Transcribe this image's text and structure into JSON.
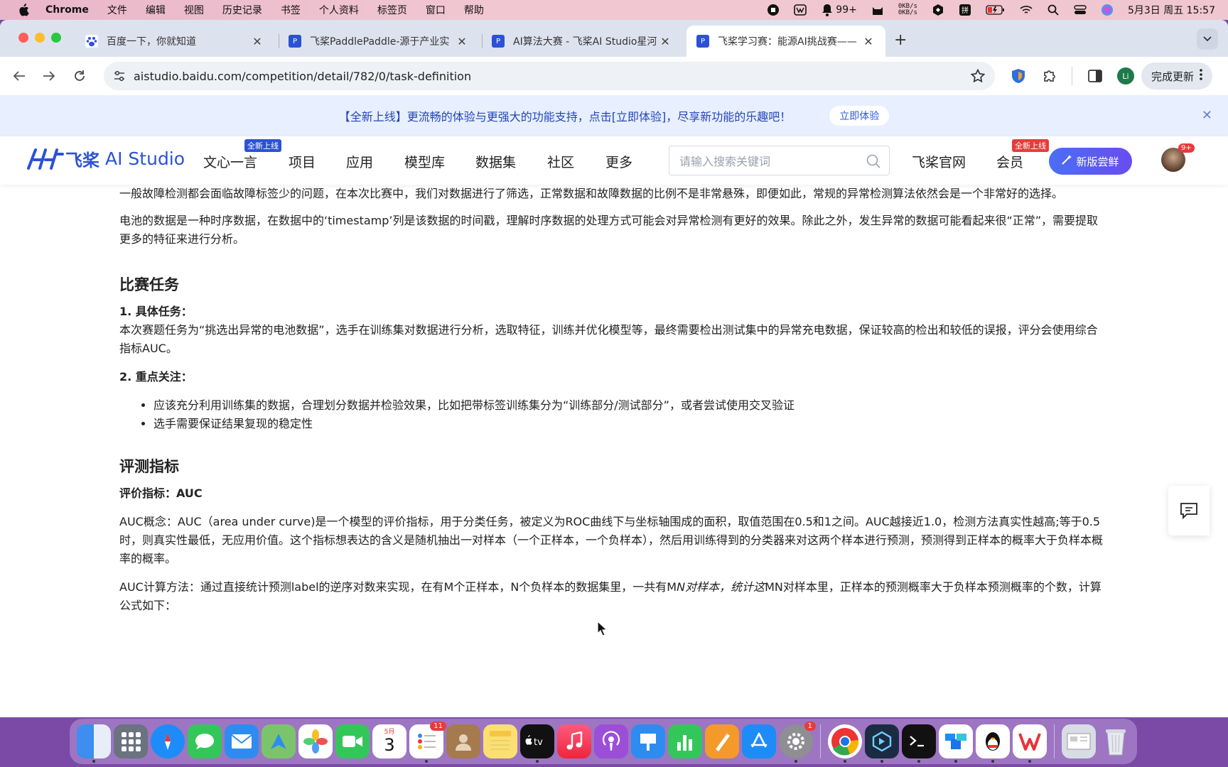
{
  "menubar": {
    "app": "Chrome",
    "items": [
      "文件",
      "编辑",
      "视图",
      "历史记录",
      "书签",
      "个人资料",
      "标签页",
      "窗口",
      "帮助"
    ],
    "notif_count": "99+",
    "speed_up": "0KB/s",
    "speed_down": "0KB/s",
    "datetime": "5月3日 周五 15:57"
  },
  "tabs": [
    {
      "title": "百度一下，你就知道",
      "icon": "baidu-paw-icon"
    },
    {
      "title": "飞桨PaddlePaddle-源于产业实",
      "icon": "paddle-logo-icon"
    },
    {
      "title": "AI算法大赛 - 飞桨AI Studio星河",
      "icon": "paddle-logo-icon"
    },
    {
      "title": "飞桨学习赛：能源AI挑战赛——",
      "icon": "paddle-logo-icon"
    }
  ],
  "toolbar": {
    "url": "aistudio.baidu.com/competition/detail/782/0/task-definition",
    "profile_initial": "Li",
    "update_label": "完成更新"
  },
  "banner": {
    "text": "【全新上线】更流畅的体验与更强大的功能支持，点击[立即体验]，尽享新功能的乐趣吧！",
    "cta": "立即体验"
  },
  "header": {
    "logo_cn": "飞桨",
    "logo_en": "AI Studio",
    "nav": [
      "文心一言",
      "项目",
      "应用",
      "模型库",
      "数据集",
      "社区",
      "更多"
    ],
    "new_badge": "全新上线",
    "search_placeholder": "请输入搜索关键词",
    "official": "飞桨官网",
    "member": "会员",
    "member_badge": "全新上线",
    "new_version": "新版尝鲜",
    "avatar_badge": "9+"
  },
  "article": {
    "p1": "一般故障检测都会面临故障标签少的问题，在本次比赛中，我们对数据进行了筛选，正常数据和故障数据的比例不是非常悬殊，即便如此，常规的异常检测算法依然会是一个非常好的选择。",
    "p2": "电池的数据是一种时序数据，在数据中的‘timestamp’列是该数据的时间戳，理解时序数据的处理方式可能会对异常检测有更好的效果。除此之外，发生异常的数据可能看起来很“正常”，需要提取更多的特征来进行分析。",
    "h_task": "比赛任务",
    "task1_title": "1. 具体任务：",
    "task1_body": "本次赛题任务为“挑选出异常的电池数据”，选手在训练集对数据进行分析，选取特征，训练并优化模型等，最终需要检出测试集中的异常充电数据，保证较高的检出和较低的误报，评分会使用综合指标AUC。",
    "task2_title": "2. 重点关注：",
    "bullets": [
      "应该充分利用训练集的数据，合理划分数据并检验效果，比如把带标签训练集分为“训练部分/测试部分”，或者尝试使用交叉验证",
      "选手需要保证结果复现的稳定性"
    ],
    "h_metric": "评测指标",
    "metric_line": "评价指标：AUC",
    "auc_concept": "AUC概念：AUC（area under curve)是一个模型的评价指标，用于分类任务，被定义为ROC曲线下与坐标轴围成的面积，取值范围在0.5和1之间。AUC越接近1.0，检测方法真实性越高;等于0.5时，则真实性最低，无应用价值。这个指标想表达的含义是随机抽出一对样本（一个正样本，一个负样本），然后用训练得到的分类器来对这两个样本进行预测，预测得到正样本的概率大于负样本概率的概率。",
    "auc_calc_a": "AUC计算方法：通过直接统计预测label的逆序对数来实现，在有M个正样本，N个负样本的数据集里，一共有M",
    "auc_calc_em": "N对样本，统计这",
    "auc_calc_b": "MN对样本里，正样本的预测概率大于负样本预测概率的个数，计算公式如下："
  },
  "dock": {
    "calendar_month": "5月",
    "calendar_day": "3",
    "reminders_badge": "11",
    "settings_badge": "1"
  }
}
